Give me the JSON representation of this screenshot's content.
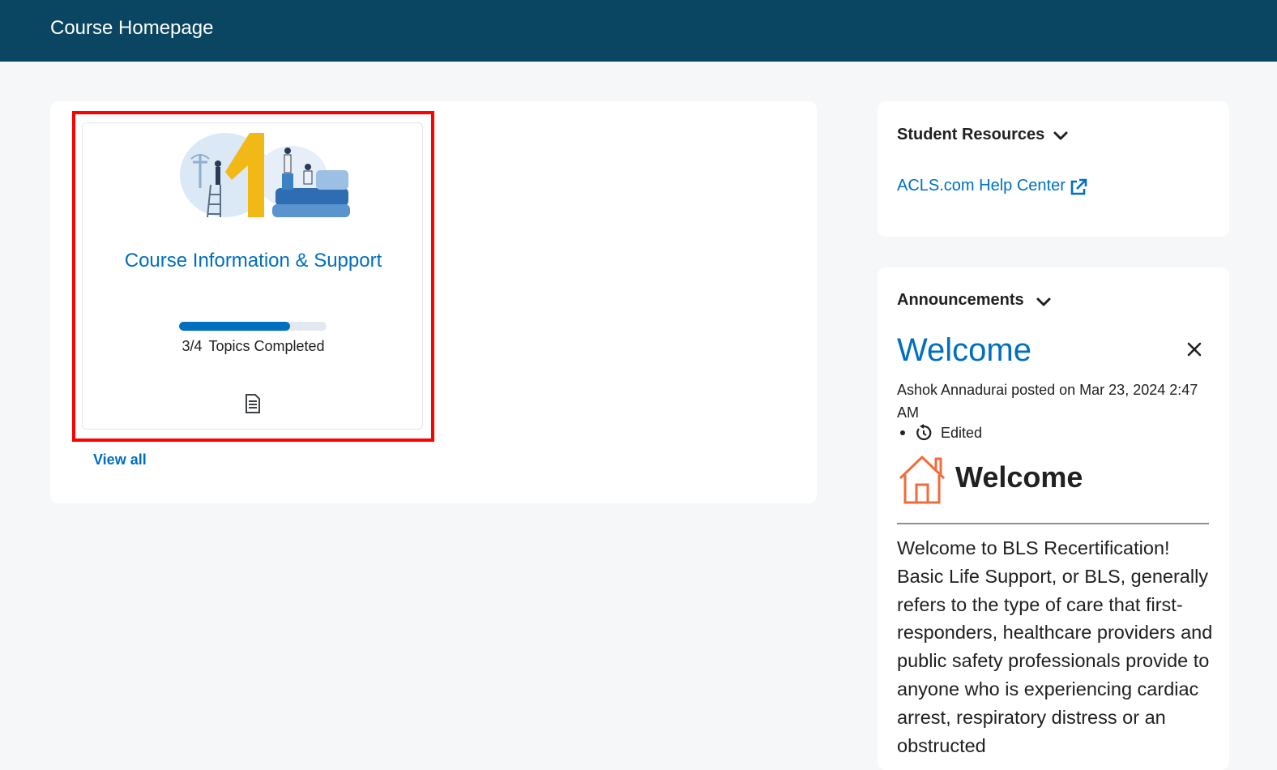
{
  "header": {
    "title": "Course Homepage"
  },
  "content": {
    "card": {
      "title": "Course Information & Support",
      "progress_fraction": "3/4",
      "progress_value": 0.75,
      "progress_label": "Topics Completed",
      "icon": "document-icon"
    },
    "view_all_label": "View all"
  },
  "student_resources": {
    "heading": "Student Resources",
    "link_label": "ACLS.com Help Center",
    "link_icon": "external-link-icon"
  },
  "announcements": {
    "heading": "Announcements",
    "item": {
      "title": "Welcome",
      "posted_by": "Ashok Annadurai posted on Mar 23, 2024 2:47 AM",
      "edited_label": "Edited",
      "body_heading": "Welcome",
      "body_text": "Welcome to BLS Recertification! Basic Life Support, or BLS, generally refers to the type of care that first-responders, healthcare providers and public safety professionals provide to anyone who is experiencing cardiac arrest, respiratory distress or an obstructed"
    }
  },
  "colors": {
    "header_bg": "#0a4661",
    "link": "#006fbf",
    "highlight": "#ff0000",
    "house_icon": "#f26b3a"
  }
}
